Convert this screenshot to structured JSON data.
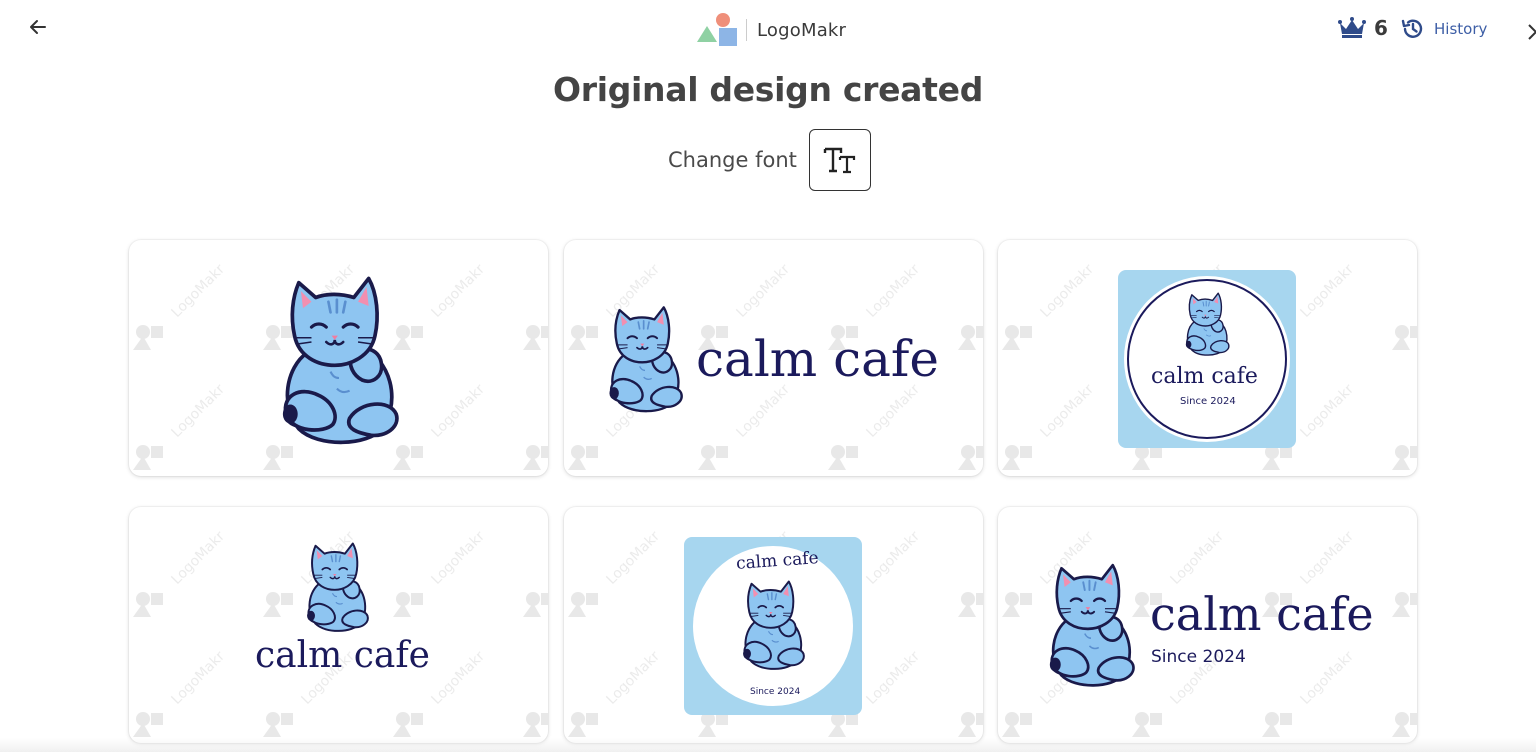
{
  "app": {
    "brand_name": "LogoMakr",
    "credits_count": "6",
    "history_label": "History"
  },
  "main": {
    "title": "Original design created",
    "change_font_label": "Change font",
    "font_button_glyph": "Tт"
  },
  "watermark_text": "LogoMakr",
  "designs": [
    {
      "layout": "icon-only"
    },
    {
      "layout": "icon-left-wordmark",
      "wordmark": "calm cafe"
    },
    {
      "layout": "badge-square",
      "wordmark": "calm cafe",
      "tagline": "Since 2024"
    },
    {
      "layout": "icon-top-wordmark",
      "wordmark": "calm cafe"
    },
    {
      "layout": "badge-arched",
      "wordmark": "calm cafe",
      "tagline": "Since 2024"
    },
    {
      "layout": "icon-left-wordmark-tagline",
      "wordmark": "calm cafe",
      "tagline": "Since 2024"
    }
  ],
  "colors": {
    "wordmark": "#1b1a5c",
    "cat_body": "#8ec5f1",
    "badge_bg": "#a7d6ef",
    "history": "#3d5ea6",
    "crown": "#2f4b8a"
  },
  "icons": [
    "back-arrow-icon",
    "logomakr-mark-icon",
    "crown-icon",
    "history-icon",
    "text-font-icon",
    "cat-icon"
  ]
}
